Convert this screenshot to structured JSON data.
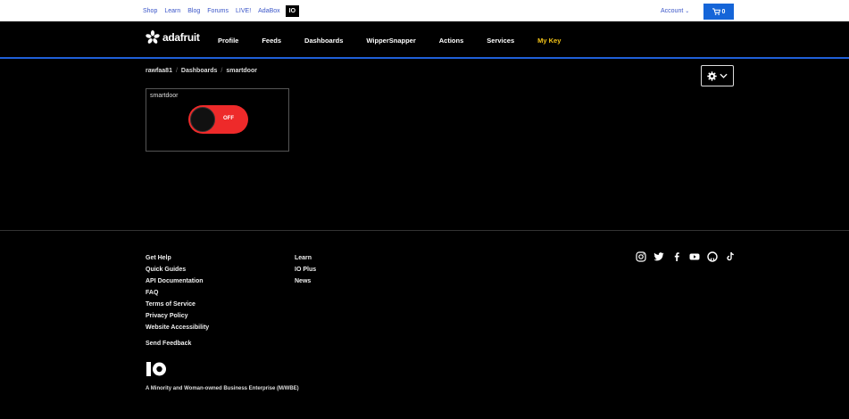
{
  "topnav": {
    "links": [
      "Shop",
      "Learn",
      "Blog",
      "Forums",
      "LIVE!",
      "AdaBox",
      "IO"
    ],
    "account": "Account",
    "cart_count": "0"
  },
  "mainnav": {
    "logo_text": "adafruit",
    "links": [
      "Profile",
      "Feeds",
      "Dashboards",
      "WipperSnapper",
      "Actions",
      "Services",
      "My Key"
    ]
  },
  "breadcrumb": [
    "rawfaa81",
    "Dashboards",
    "smartdoor"
  ],
  "block": {
    "title": "smartdoor",
    "toggle_state": "OFF",
    "toggle_on_color": "#ee2a2a"
  },
  "footer": {
    "col1": [
      "Get Help",
      "Quick Guides",
      "API Documentation",
      "FAQ",
      "Terms of Service",
      "Privacy Policy",
      "Website Accessibility"
    ],
    "feedback": "Send Feedback",
    "col2": [
      "Learn",
      "IO Plus",
      "News"
    ],
    "social_icons": [
      "instagram-icon",
      "twitter-icon",
      "facebook-icon",
      "youtube-icon",
      "github-icon",
      "tiktok-icon"
    ],
    "tagline": "A Minority and Woman-owned Business Enterprise (M/WBE)"
  },
  "colors": {
    "accent_blue": "#1f5fd8",
    "mykey_yellow": "#f5c518",
    "cart_blue": "#1565d8"
  }
}
